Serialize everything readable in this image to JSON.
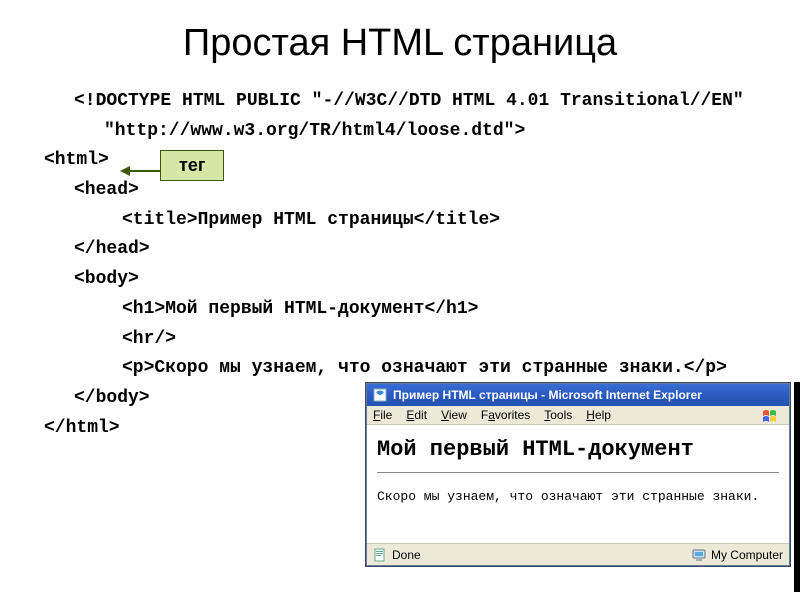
{
  "slide": {
    "title": "Простая HTML страница"
  },
  "callout": {
    "label": "тег"
  },
  "code": {
    "doctype": "<!DOCTYPE HTML PUBLIC \"-//W3C//DTD HTML 4.01 Transitional//EN\" \"http://www.w3.org/TR/html4/loose.dtd\">",
    "html_open": "<html>",
    "head_open": "<head>",
    "title_line": "<title>Пример HTML страницы</title>",
    "head_close": "</head>",
    "body_open": "<body>",
    "h1_line": "<h1>Мой первый HTML-документ</h1>",
    "hr_line": "<hr/>",
    "p_line": "<p>Скоро мы узнаем, что означают эти странные знаки.</p>",
    "body_close": "</body>",
    "html_close": "</html>"
  },
  "browser": {
    "title": "Пример HTML страницы - Microsoft Internet Explorer",
    "menu": {
      "file": "File",
      "edit": "Edit",
      "view": "View",
      "favorites": "Favorites",
      "tools": "Tools",
      "help": "Help"
    },
    "page": {
      "heading": "Мой первый HTML-документ",
      "paragraph": "Скоро мы узнаем, что означают эти странные знаки."
    },
    "status": {
      "done": "Done",
      "zone": "My Computer"
    }
  }
}
